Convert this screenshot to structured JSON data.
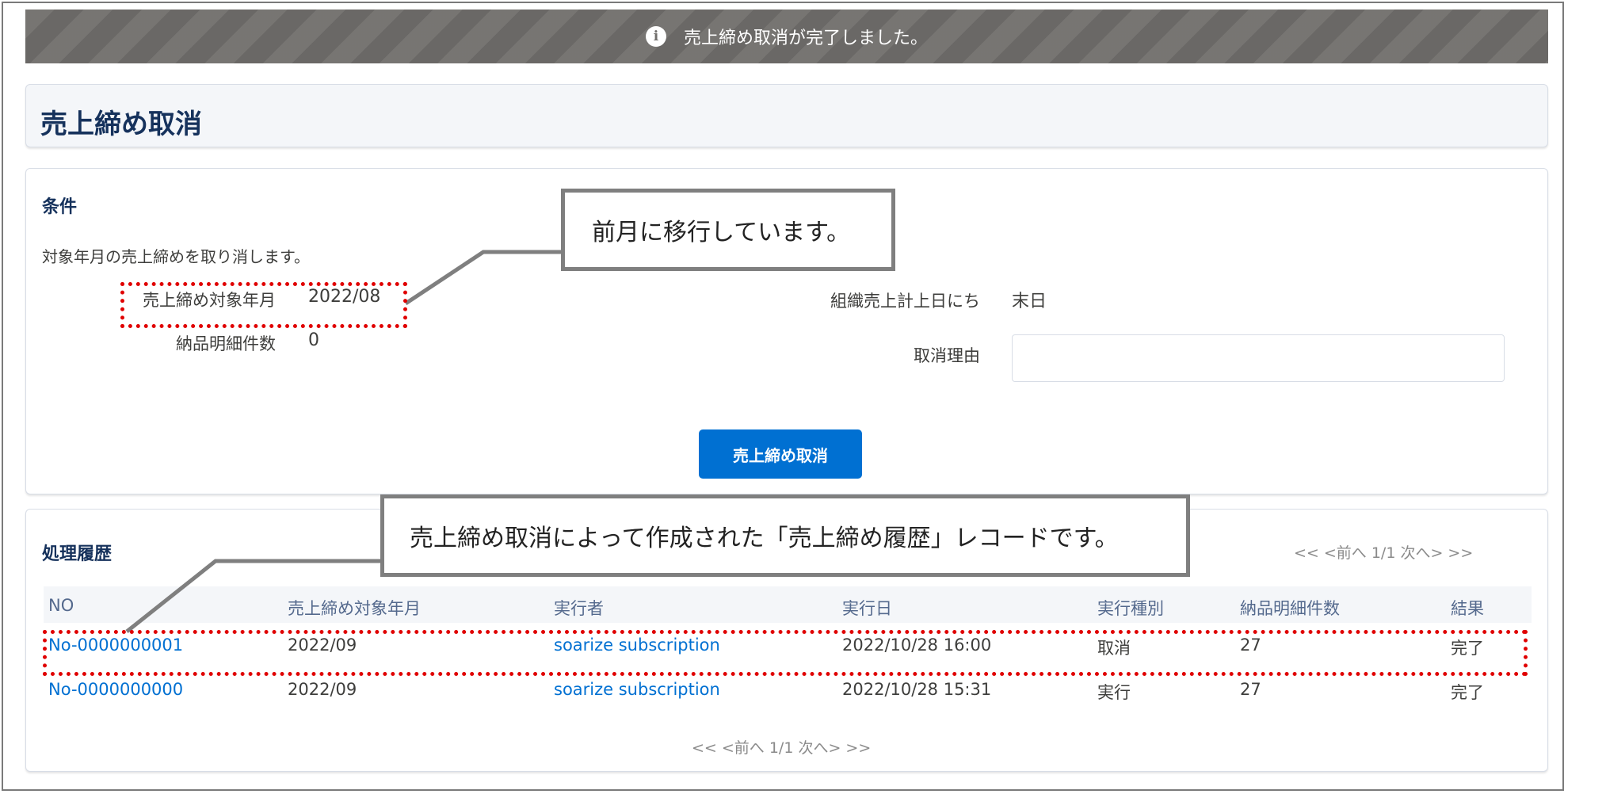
{
  "toast": {
    "message": "売上締め取消が完了しました。",
    "icon": "info-icon"
  },
  "page": {
    "title": "売上締め取消"
  },
  "condition": {
    "heading": "条件",
    "description": "対象年月の売上締めを取り消します。",
    "target_month_label": "売上締め対象年月",
    "target_month_value": "2022/08",
    "delivery_count_label": "納品明細件数",
    "delivery_count_value": "0",
    "org_sales_day_label": "組織売上計上日にち",
    "org_sales_day_value": "末日",
    "reason_label": "取消理由",
    "reason_value": "",
    "submit_label": "売上締め取消"
  },
  "history": {
    "heading": "処理履歴",
    "pager_top": "<< <前へ 1/1  次へ> >>",
    "pager_bottom": "<< <前へ 1/1  次へ> >>",
    "columns": [
      "NO",
      "売上締め対象年月",
      "実行者",
      "実行日",
      "実行種別",
      "納品明細件数",
      "結果"
    ],
    "rows": [
      {
        "no": "No-0000000001",
        "month": "2022/09",
        "user": "soarize subscription",
        "date": "2022/10/28 16:00",
        "type": "取消",
        "count": "27",
        "result": "完了"
      },
      {
        "no": "No-0000000000",
        "month": "2022/09",
        "user": "soarize subscription",
        "date": "2022/10/28 15:31",
        "type": "実行",
        "count": "27",
        "result": "完了"
      }
    ]
  },
  "annotations": {
    "callout_month": "前月に移行しています。",
    "callout_record": "売上締め取消によって作成された「売上締め履歴」レコードです。"
  },
  "colors": {
    "toast_bg": "#706e6b",
    "primary": "#0070d2",
    "heading": "#16325c",
    "annotation_border": "#e00000",
    "callout_border": "#7f7f7f"
  }
}
